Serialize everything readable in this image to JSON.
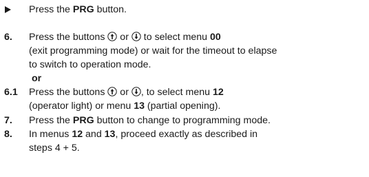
{
  "step_bullet": {
    "pre": "Press the ",
    "bold": "PRG",
    "post": " button."
  },
  "step6": {
    "number": "6.",
    "line1_pre": "Press the buttons ",
    "line1_or": " or ",
    "line1_mid": " to select menu ",
    "line1_menu": "00",
    "line2": "(exit programming mode) or wait for the timeout to elapse",
    "line3": "to switch to operation mode.",
    "or_word": "or"
  },
  "step6_1": {
    "number": "6.1",
    "line1_pre": "Press the buttons ",
    "line1_or": " or ",
    "line1_mid": ", to select menu ",
    "line1_menu": "12",
    "line2_pre": "(operator light) or menu ",
    "line2_menu": "13",
    "line2_post": " (partial opening)."
  },
  "step7": {
    "number": "7.",
    "pre": "Press the ",
    "bold": "PRG",
    "post": " button to change to programming mode."
  },
  "step8": {
    "number": "8.",
    "line1_pre": "In menus ",
    "menu_a": "12",
    "line1_and": " and ",
    "menu_b": "13",
    "line1_post": ", proceed exactly as described in",
    "line2": "steps 4 + 5."
  },
  "icons": {
    "up": "arrow-up-button-icon",
    "down": "arrow-down-button-icon"
  }
}
